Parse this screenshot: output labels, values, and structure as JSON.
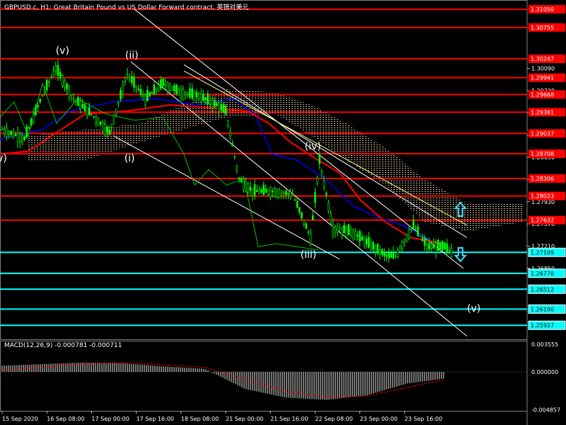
{
  "header": {
    "title": "GBPUSD.c, H1:  Great Britain Pound vs US Dollar Forward contract, 英镑对美元"
  },
  "colors": {
    "background": "#000000",
    "candle": "#00ff00",
    "resistance_line": "#ff0000",
    "support_line": "#00ffff",
    "ma_red": "#ff0000",
    "ma_blue": "#0000ff",
    "chinkou": "#00c000",
    "cloud": "#ffe4b5",
    "channel": "#ffffff",
    "macd_hist": "#c0c0c0",
    "macd_signal": "#ff0000"
  },
  "chart_data": [
    {
      "type": "line",
      "symbol": "GBPUSD.c",
      "timeframe": "H1",
      "x": [
        "15 Sep 2020",
        "16 Sep 08:00",
        "17 Sep 00:00",
        "17 Sep 16:00",
        "18 Sep 08:00",
        "21 Sep 00:00",
        "21 Sep 16:00",
        "22 Sep 08:00",
        "23 Sep 00:00",
        "23 Sep 16:00"
      ],
      "ylim": [
        1.257,
        1.312
      ],
      "y_ticks": [
        1.3009,
        1.2973,
        1.2937,
        1.2901,
        1.2865,
        1.2829,
        1.2793,
        1.2757,
        1.2721,
        1.2685
      ],
      "price_series": [
        {
          "x": 0,
          "y": 1.291
        },
        {
          "x": 0.5,
          "y": 1.2895
        },
        {
          "x": 0.9,
          "y": 1.2965
        },
        {
          "x": 1.2,
          "y": 1.301
        },
        {
          "x": 1.6,
          "y": 1.296
        },
        {
          "x": 2.0,
          "y": 1.2935
        },
        {
          "x": 2.4,
          "y": 1.2905
        },
        {
          "x": 2.8,
          "y": 1.3
        },
        {
          "x": 3.2,
          "y": 1.296
        },
        {
          "x": 3.6,
          "y": 1.2985
        },
        {
          "x": 4.0,
          "y": 1.297
        },
        {
          "x": 4.4,
          "y": 1.2965
        },
        {
          "x": 4.8,
          "y": 1.295
        },
        {
          "x": 5.0,
          "y": 1.294
        },
        {
          "x": 5.3,
          "y": 1.283
        },
        {
          "x": 5.6,
          "y": 1.281
        },
        {
          "x": 6.0,
          "y": 1.281
        },
        {
          "x": 6.5,
          "y": 1.2805
        },
        {
          "x": 6.9,
          "y": 1.2735
        },
        {
          "x": 7.1,
          "y": 1.286
        },
        {
          "x": 7.4,
          "y": 1.275
        },
        {
          "x": 7.8,
          "y": 1.2745
        },
        {
          "x": 8.2,
          "y": 1.2725
        },
        {
          "x": 8.6,
          "y": 1.2705
        },
        {
          "x": 8.8,
          "y": 1.2705
        },
        {
          "x": 9.2,
          "y": 1.2755
        },
        {
          "x": 9.5,
          "y": 1.272
        },
        {
          "x": 9.9,
          "y": 1.272
        },
        {
          "x": 10.1,
          "y": 1.271
        }
      ],
      "horizontal_levels": [
        {
          "value": "1.31050",
          "kind": "resistance"
        },
        {
          "value": "1.30755",
          "kind": "resistance"
        },
        {
          "value": "1.30247",
          "kind": "resistance"
        },
        {
          "value": "1.29941",
          "kind": "resistance"
        },
        {
          "value": "1.29668",
          "kind": "resistance"
        },
        {
          "value": "1.29381",
          "kind": "resistance"
        },
        {
          "value": "1.29037",
          "kind": "resistance"
        },
        {
          "value": "1.28708",
          "kind": "resistance"
        },
        {
          "value": "1.28306",
          "kind": "resistance"
        },
        {
          "value": "1.28023",
          "kind": "resistance"
        },
        {
          "value": "1.27632",
          "kind": "resistance"
        },
        {
          "value": "1.27109",
          "kind": "support"
        },
        {
          "value": "1.26770",
          "kind": "support"
        },
        {
          "value": "1.26512",
          "kind": "support"
        },
        {
          "value": "1.26190",
          "kind": "support"
        },
        {
          "value": "1.25927",
          "kind": "support"
        }
      ],
      "wave_labels": [
        {
          "text": "(v)",
          "x": 1.35,
          "y": 1.3033
        },
        {
          "text": "(ii)",
          "x": 2.9,
          "y": 1.3025
        },
        {
          "text": "(i)",
          "x": 2.85,
          "y": 1.2858
        },
        {
          "text": "v)",
          "x": 0.0,
          "y": 1.2858
        },
        {
          "text": "(iv)",
          "x": 6.95,
          "y": 1.2878
        },
        {
          "text": "(iii)",
          "x": 6.85,
          "y": 1.2702
        },
        {
          "text": "(v)",
          "x": 10.55,
          "y": 1.2615
        }
      ],
      "arrows": [
        {
          "direction": "up",
          "x": 10.25,
          "y": 1.278
        },
        {
          "direction": "down",
          "x": 10.25,
          "y": 1.2708
        }
      ]
    },
    {
      "type": "bar",
      "title": "MACD(12,26,9) -0.000781 -0.000711",
      "x": [
        "15 Sep 2020",
        "16 Sep 08:00",
        "17 Sep 00:00",
        "17 Sep 16:00",
        "18 Sep 08:00",
        "21 Sep 00:00",
        "21 Sep 16:00",
        "22 Sep 08:00",
        "23 Sep 00:00",
        "23 Sep 16:00"
      ],
      "ylim": [
        -0.005,
        0.004
      ],
      "y_ticks": [
        "0.003555",
        "0.000000",
        "-0.004857"
      ],
      "series": [
        {
          "values": [
            0.0008,
            0.001,
            0.0012,
            0.0011,
            0.0007,
            0.0004,
            -0.0022,
            -0.0033,
            -0.0036,
            -0.003,
            -0.0015,
            -0.0008
          ]
        },
        {
          "values": [
            0.0002,
            0.0006,
            0.001,
            0.0012,
            0.0009,
            0.0006,
            -0.001,
            -0.0025,
            -0.0032,
            -0.0031,
            -0.002,
            -0.0009
          ]
        }
      ]
    }
  ]
}
